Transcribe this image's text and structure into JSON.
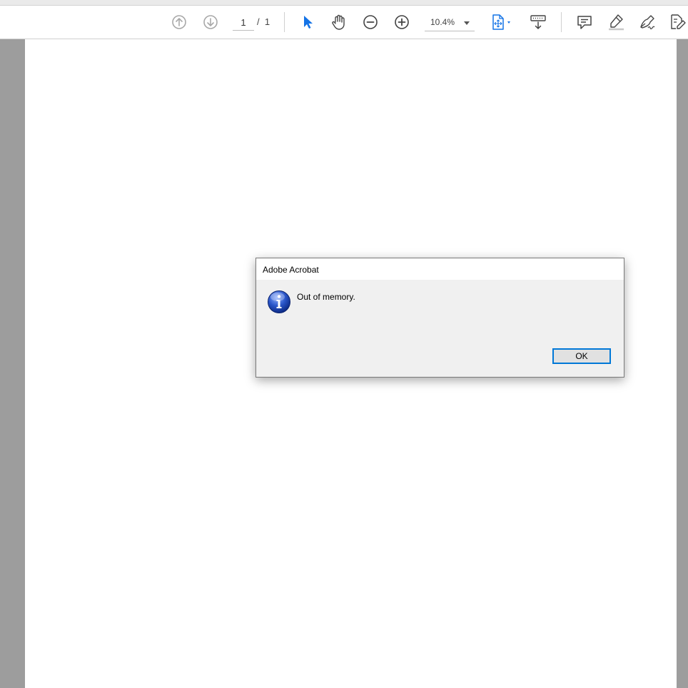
{
  "toolbar": {
    "page_current": "1",
    "page_total": "/  1",
    "zoom_value": "10.4%",
    "icons": [
      "prev-page-icon",
      "next-page-icon",
      "select-tool-icon",
      "hand-tool-icon",
      "zoom-out-icon",
      "zoom-in-icon",
      "page-fit-icon",
      "scroll-mode-icon",
      "comment-icon",
      "highlight-icon",
      "sign-icon",
      "edit-icon"
    ],
    "colors": {
      "accent": "#1473e6",
      "icon_gray": "#555555",
      "icon_disabled": "#a8a8a8"
    }
  },
  "dialog": {
    "title": "Adobe Acrobat",
    "message": "Out of memory.",
    "ok_label": "OK",
    "icon": "info-icon",
    "colors": {
      "focus_border": "#0078d7",
      "info_blue": "#1f4fbf"
    }
  }
}
